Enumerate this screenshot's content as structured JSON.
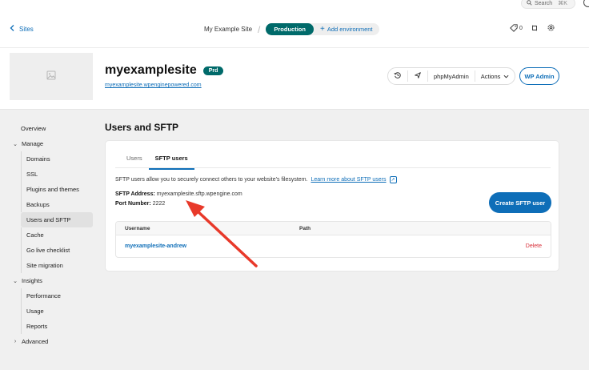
{
  "topbar": {
    "search_label": "Search",
    "search_shortcut": "⌘K"
  },
  "header": {
    "back_label": "Sites",
    "site_name": "My Example Site",
    "environment": "Production",
    "add_environment": "Add environment",
    "tags_count": "0"
  },
  "site": {
    "name": "myexamplesite",
    "badge": "Prd",
    "url": "myexamplesite.wpenginepowered.com",
    "toolbar": {
      "phpmyadmin": "phpMyAdmin",
      "actions": "Actions"
    },
    "wp_admin": "WP Admin"
  },
  "sidebar": {
    "overview": "Overview",
    "manage": "Manage",
    "manage_items": [
      "Domains",
      "SSL",
      "Plugins and themes",
      "Backups",
      "Users and SFTP",
      "Cache",
      "Go live checklist",
      "Site migration"
    ],
    "insights": "Insights",
    "insights_items": [
      "Performance",
      "Usage",
      "Reports"
    ],
    "advanced": "Advanced",
    "active_item": "Users and SFTP"
  },
  "main": {
    "title": "Users and SFTP",
    "tabs": [
      "Users",
      "SFTP users"
    ],
    "active_tab": "SFTP users",
    "description": "SFTP users allow you to securely connect others to your website's filesystem.",
    "learn_more": "Learn more about SFTP users",
    "sftp_address_label": "SFTP Address:",
    "sftp_address_value": "myexamplesite.sftp.wpengine.com",
    "port_label": "Port Number:",
    "port_value": "2222",
    "create_button": "Create SFTP user",
    "table": {
      "columns": [
        "Username",
        "Path"
      ],
      "rows": [
        {
          "username": "myexamplesite-andrew",
          "path": "",
          "action": "Delete"
        }
      ]
    }
  },
  "colors": {
    "accent_blue": "#0e6eb8",
    "environment_teal": "#006a6a",
    "delete_red": "#d8303a",
    "annotation_arrow": "#e8392a"
  }
}
